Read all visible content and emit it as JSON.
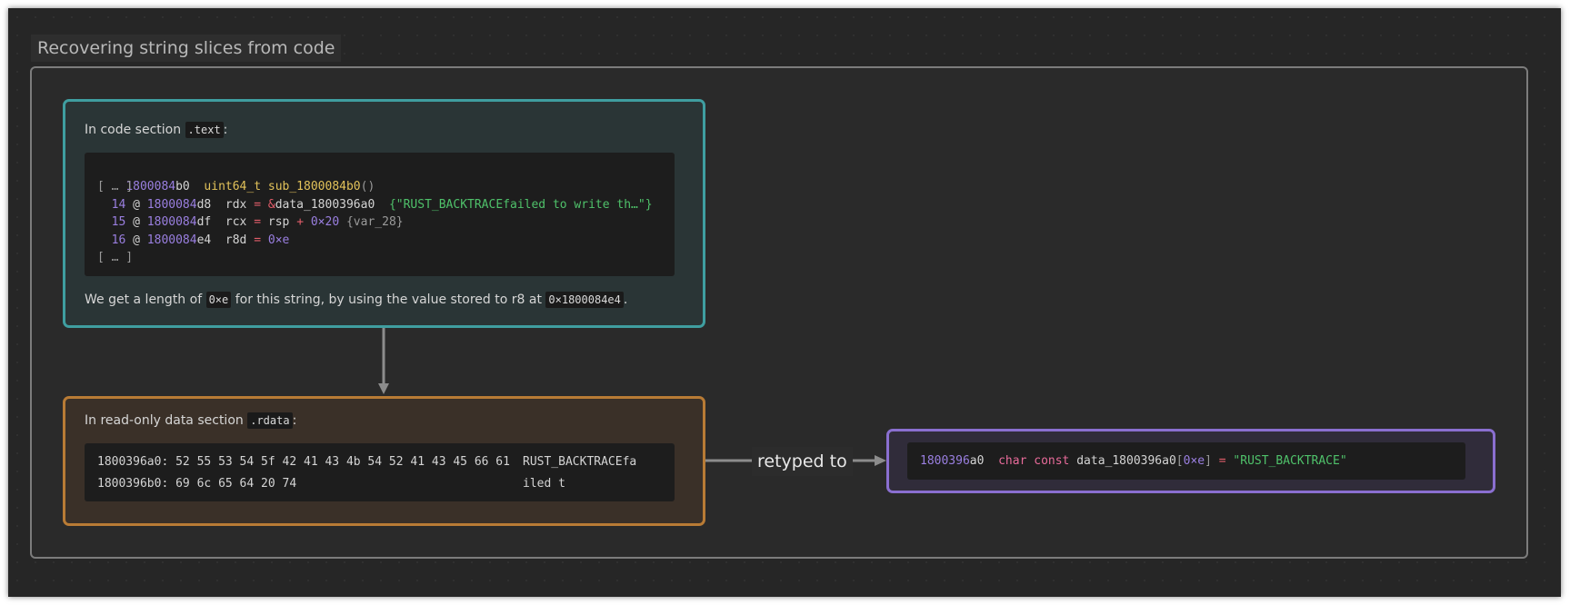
{
  "group_title": "Recovering string slices from code",
  "text_node": {
    "intro": "In code section ",
    "section": ".text",
    "intro_end": ":",
    "header_addr_hi": "1800084",
    "header_addr_lo": "b0",
    "header_type": "uint64_t",
    "header_func": "sub_1800084b0",
    "header_parens": "()",
    "ellipsis": "[ … ]",
    "lines": [
      {
        "idx": "14",
        "at": "@",
        "addr_hi": "1800084",
        "addr_lo": "d8",
        "dst": "rdx",
        "eq": "=",
        "amp": "&",
        "src": "data_1800396a0",
        "str": "{\"RUST_BACKTRACEfailed to write th…\"}"
      },
      {
        "idx": "15",
        "at": "@",
        "addr_hi": "1800084",
        "addr_lo": "df",
        "dst": "rcx",
        "eq": "=",
        "src": "rsp",
        "plus": "+",
        "imm": "0×20",
        "var": "{var_28}"
      },
      {
        "idx": "16",
        "at": "@",
        "addr_hi": "1800084",
        "addr_lo": "e4",
        "dst": "r8d",
        "eq": "=",
        "imm": "0×e"
      }
    ],
    "ellipsis_end": "[ … ]",
    "note_a": "We get a length of ",
    "note_len": "0×e",
    "note_b": " for this string, by using the value stored to r8 at ",
    "note_addr": "0×1800084e4",
    "note_c": "."
  },
  "rdata_node": {
    "intro": "In read-only data section ",
    "section": ".rdata",
    "intro_end": ":",
    "rows": [
      {
        "addr": "1800396a0:",
        "bytes": "52 55 53 54 5f 42 41 43 4b 54 52 41 43 45 66 61",
        "ascii": "RUST_BACKTRACEfa"
      },
      {
        "addr": "1800396b0:",
        "bytes": "69 6c 65 64 20 74",
        "ascii": "iled t"
      }
    ]
  },
  "edge_label": "retyped to",
  "result_node": {
    "addr_hi": "1800396",
    "addr_lo": "a0",
    "kw": "char const",
    "name": "data_1800396a0",
    "bracket_open": "[",
    "size": "0×e",
    "bracket_close": "]",
    "eq": "=",
    "value": "\"RUST_BACKTRACE\""
  },
  "colors": {
    "text_node_border": "#3f9ea0",
    "rdata_node_border": "#b87b35",
    "result_node_border": "#8a6fd0",
    "edge": "#8c8c8c"
  }
}
